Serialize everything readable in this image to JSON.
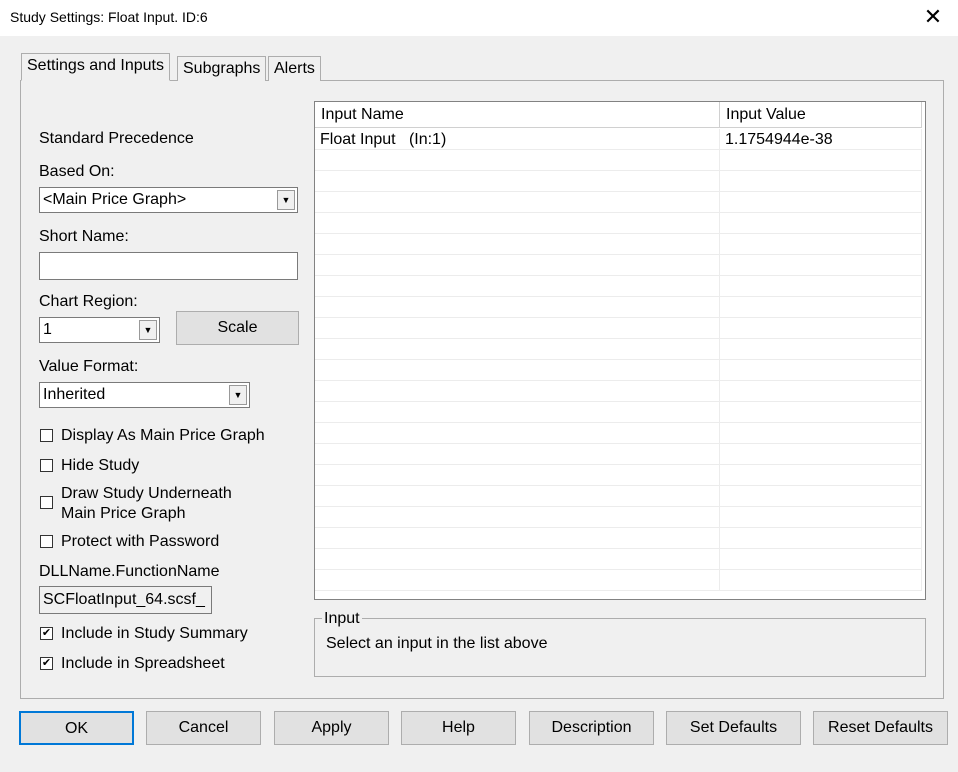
{
  "window": {
    "title": "Study Settings: Float Input. ID:6",
    "close": "✕"
  },
  "tabs": [
    "Settings and Inputs",
    "Subgraphs",
    "Alerts"
  ],
  "left": {
    "precedence": "Standard Precedence",
    "based_on_label": "Based On:",
    "based_on_value": "<Main Price Graph>",
    "short_name_label": "Short Name:",
    "short_name_value": "",
    "chart_region_label": "Chart Region:",
    "chart_region_value": "1",
    "scale_button": "Scale",
    "value_format_label": "Value Format:",
    "value_format_value": "Inherited",
    "checkboxes": [
      {
        "label": "Display As Main Price Graph",
        "checked": false
      },
      {
        "label": "Hide Study",
        "checked": false
      },
      {
        "label": "Draw Study Underneath",
        "label2": "Main Price Graph",
        "checked": false
      },
      {
        "label": "Protect with Password",
        "checked": false
      }
    ],
    "dll_label": "DLLName.FunctionName",
    "dll_value": "SCFloatInput_64.scsf_",
    "checkboxes2": [
      {
        "label": "Include in Study Summary",
        "checked": true
      },
      {
        "label": "Include in Spreadsheet",
        "checked": true
      }
    ]
  },
  "grid": {
    "headers": [
      "Input Name",
      "Input Value"
    ],
    "rows": [
      {
        "name": "Float Input   (In:1)",
        "value": "1.1754944e-38"
      }
    ]
  },
  "input_group": {
    "title": "Input",
    "text": "Select an input in the list above"
  },
  "buttons": [
    "OK",
    "Cancel",
    "Apply",
    "Help",
    "Description",
    "Set Defaults",
    "Reset Defaults"
  ]
}
